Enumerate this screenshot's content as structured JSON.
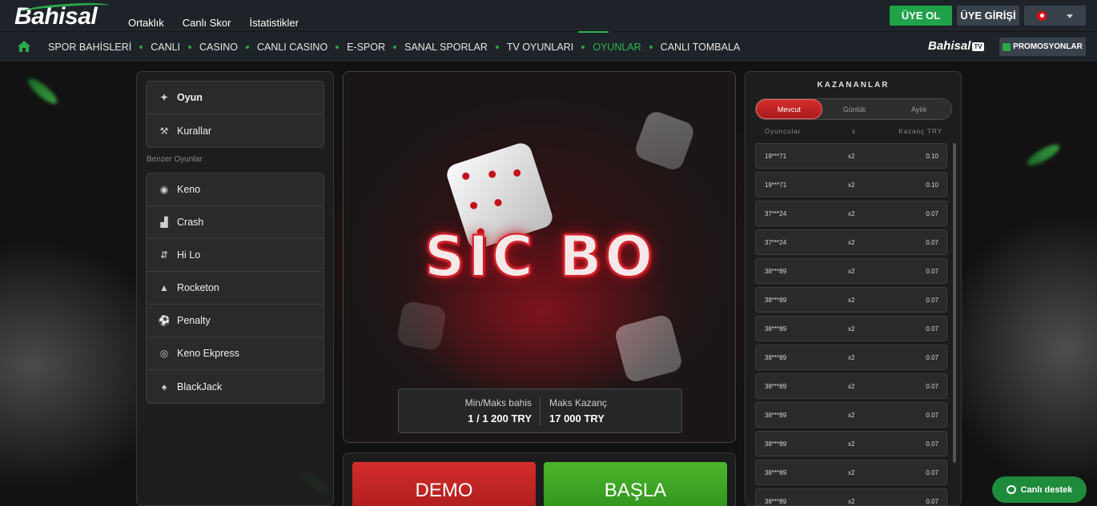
{
  "brand": {
    "logo_text": "Bahisal",
    "tv_text": "Bahisal",
    "tv_badge": "TV"
  },
  "topnav": [
    "Ortaklık",
    "Canlı Skor",
    "İstatistikler"
  ],
  "header_buttons": {
    "register": "ÜYE OL",
    "login": "ÜYE GİRİŞİ"
  },
  "mainnav": [
    {
      "label": "SPOR BAHİSLERİ",
      "active": false
    },
    {
      "label": "CANLI",
      "active": false
    },
    {
      "label": "CASINO",
      "active": false
    },
    {
      "label": "CANLI CASINO",
      "active": false
    },
    {
      "label": "E-SPOR",
      "active": false
    },
    {
      "label": "SANAL SPORLAR",
      "active": false
    },
    {
      "label": "TV OYUNLARI",
      "active": false
    },
    {
      "label": "OYUNLAR",
      "active": true
    },
    {
      "label": "CANLI TOMBALA",
      "active": false
    }
  ],
  "promotions_label": "PROMOSYONLAR",
  "left_menu": {
    "main": [
      {
        "label": "Oyun",
        "icon": "dice-icon"
      },
      {
        "label": "Kurallar",
        "icon": "gavel-icon"
      }
    ],
    "similar_title": "Benzer Oyunlar",
    "similar": [
      {
        "label": "Keno",
        "icon": "keno-icon"
      },
      {
        "label": "Crash",
        "icon": "chart-bars-icon"
      },
      {
        "label": "Hi Lo",
        "icon": "hilo-icon"
      },
      {
        "label": "Rocketon",
        "icon": "rocket-icon"
      },
      {
        "label": "Penalty",
        "icon": "soccer-ball-icon"
      },
      {
        "label": "Keno Ekpress",
        "icon": "keno-express-icon"
      },
      {
        "label": "BlackJack",
        "icon": "cards-icon"
      }
    ]
  },
  "game": {
    "title": "SIC BO",
    "min_max_label": "Min/Maks bahis",
    "min_max_value": "1 / 1 200  TRY",
    "max_win_label": "Maks Kazanç",
    "max_win_value": "17 000  TRY",
    "demo_label": "DEMO",
    "start_label": "BAŞLA"
  },
  "winners": {
    "title": "KAZANANLAR",
    "tabs": [
      {
        "label": "Mevcut",
        "active": true
      },
      {
        "label": "Günlük",
        "active": false
      },
      {
        "label": "Aylık",
        "active": false
      }
    ],
    "columns": {
      "player": "Oyuncular",
      "multiplier": "x",
      "win": "Kazanç TRY"
    },
    "rows": [
      {
        "player": "19***71",
        "x": "x2",
        "win": "0.10"
      },
      {
        "player": "19***71",
        "x": "x2",
        "win": "0.10"
      },
      {
        "player": "37***24",
        "x": "x2",
        "win": "0.07"
      },
      {
        "player": "37***24",
        "x": "x2",
        "win": "0.07"
      },
      {
        "player": "38***89",
        "x": "x2",
        "win": "0.07"
      },
      {
        "player": "38***89",
        "x": "x2",
        "win": "0.07"
      },
      {
        "player": "38***89",
        "x": "x2",
        "win": "0.07"
      },
      {
        "player": "38***89",
        "x": "x2",
        "win": "0.07"
      },
      {
        "player": "38***89",
        "x": "x2",
        "win": "0.07"
      },
      {
        "player": "38***89",
        "x": "x2",
        "win": "0.07"
      },
      {
        "player": "38***89",
        "x": "x2",
        "win": "0.07"
      },
      {
        "player": "38***89",
        "x": "x2",
        "win": "0.07"
      },
      {
        "player": "38***89",
        "x": "x2",
        "win": "0.07"
      }
    ]
  },
  "support_label": "Canlı destek",
  "colors": {
    "accent_green": "#1fa24a",
    "accent_red": "#d42d2d",
    "nav_bg": "#1e2329"
  }
}
